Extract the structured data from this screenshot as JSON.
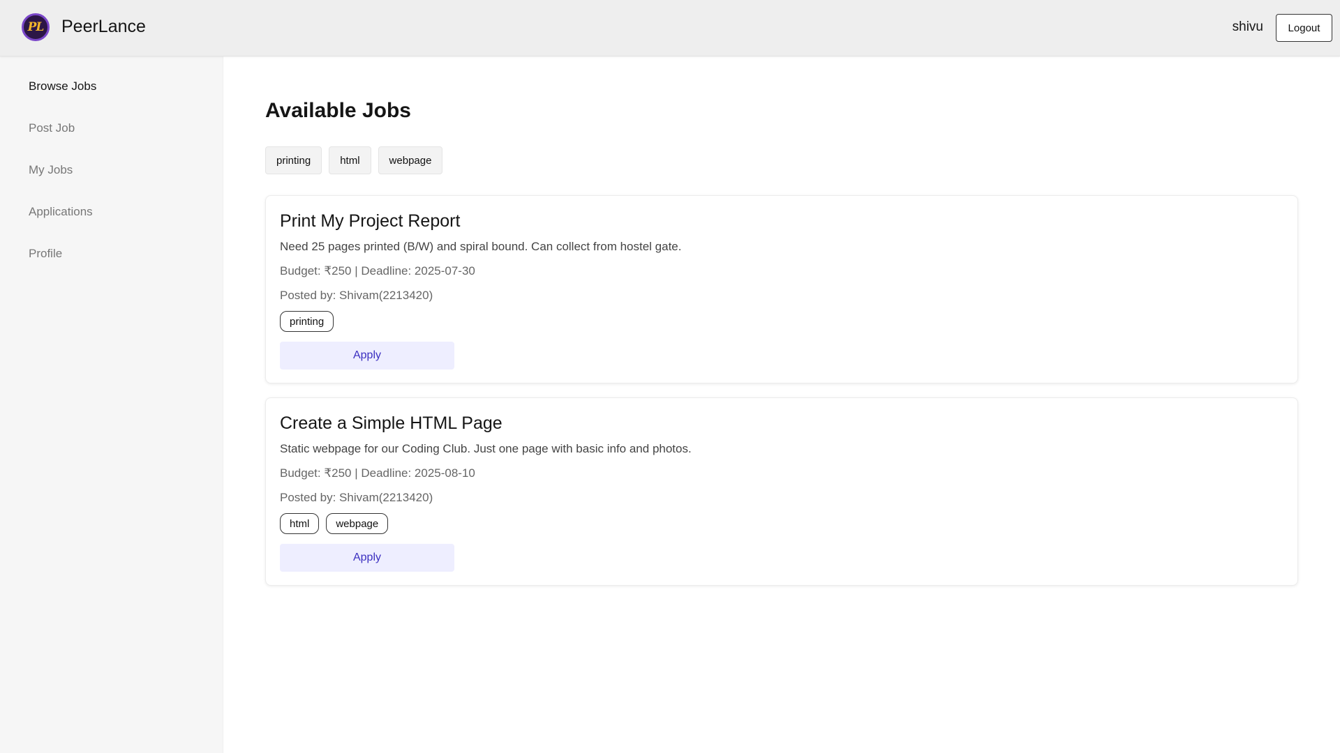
{
  "header": {
    "logo_text": "PL",
    "brand": "PeerLance",
    "username": "shivu",
    "logout_label": "Logout"
  },
  "sidebar": {
    "items": [
      {
        "label": "Browse Jobs",
        "active": true
      },
      {
        "label": "Post Job",
        "active": false
      },
      {
        "label": "My Jobs",
        "active": false
      },
      {
        "label": "Applications",
        "active": false
      },
      {
        "label": "Profile",
        "active": false
      }
    ]
  },
  "main": {
    "title": "Available Jobs",
    "filters": [
      "printing",
      "html",
      "webpage"
    ],
    "jobs": [
      {
        "title": "Print My Project Report",
        "description": "Need 25 pages printed (B/W) and spiral bound. Can collect from hostel gate.",
        "meta": "Budget: ₹250 | Deadline: 2025-07-30",
        "posted_by": "Posted by: Shivam(2213420)",
        "tags": [
          "printing"
        ],
        "apply_label": "Apply"
      },
      {
        "title": "Create a Simple HTML Page",
        "description": "Static webpage for our Coding Club. Just one page with basic info and photos.",
        "meta": "Budget: ₹250 | Deadline: 2025-08-10",
        "posted_by": "Posted by: Shivam(2213420)",
        "tags": [
          "html",
          "webpage"
        ],
        "apply_label": "Apply"
      }
    ]
  },
  "colors": {
    "header_bg": "#eeeeee",
    "sidebar_bg": "#f6f6f6",
    "apply_bg": "#eeeeff",
    "apply_text": "#3b2fc0"
  }
}
